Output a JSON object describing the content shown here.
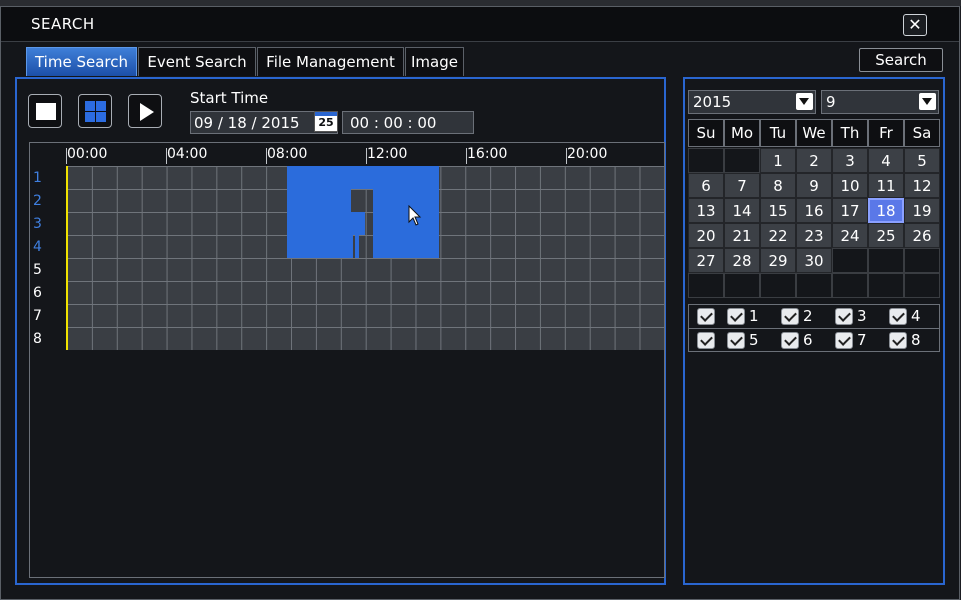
{
  "window": {
    "title": "SEARCH",
    "close_glyph": "✕"
  },
  "tabs": [
    {
      "label": "Time Search",
      "active": true
    },
    {
      "label": "Event Search",
      "active": false
    },
    {
      "label": "File Management",
      "active": false
    },
    {
      "label": "Image",
      "active": false
    }
  ],
  "search_button": "Search",
  "controls": {
    "start_time_label": "Start Time",
    "date": "09 / 18 / 2015",
    "calendar_icon_text": "25",
    "time": "00  :  00  :  00"
  },
  "timeline": {
    "hours": [
      "00:00",
      "04:00",
      "08:00",
      "12:00",
      "16:00",
      "20:00"
    ],
    "channels": [
      "1",
      "2",
      "3",
      "4",
      "5",
      "6",
      "7",
      "8"
    ],
    "channel_colors": {
      "recorded": "#3f7fe0",
      "empty": "#ffffff"
    }
  },
  "calendar": {
    "year": "2015",
    "month": "9",
    "weekdays": [
      "Su",
      "Mo",
      "Tu",
      "We",
      "Th",
      "Fr",
      "Sa"
    ],
    "days": [
      "",
      "",
      "1",
      "2",
      "3",
      "4",
      "5",
      "6",
      "7",
      "8",
      "9",
      "10",
      "11",
      "12",
      "13",
      "14",
      "15",
      "16",
      "17",
      "18",
      "19",
      "20",
      "21",
      "22",
      "23",
      "24",
      "25",
      "26",
      "27",
      "28",
      "29",
      "30",
      "",
      "",
      "",
      "",
      "",
      "",
      "",
      "",
      "",
      ""
    ],
    "selected_day": "18"
  },
  "channel_checkboxes": {
    "row1": [
      "",
      "1",
      "2",
      "3",
      "4"
    ],
    "row2": [
      "",
      "5",
      "6",
      "7",
      "8"
    ]
  },
  "colors": {
    "accent": "#2a66d0",
    "record": "#2b6cdc",
    "now_line": "#f0e200"
  }
}
